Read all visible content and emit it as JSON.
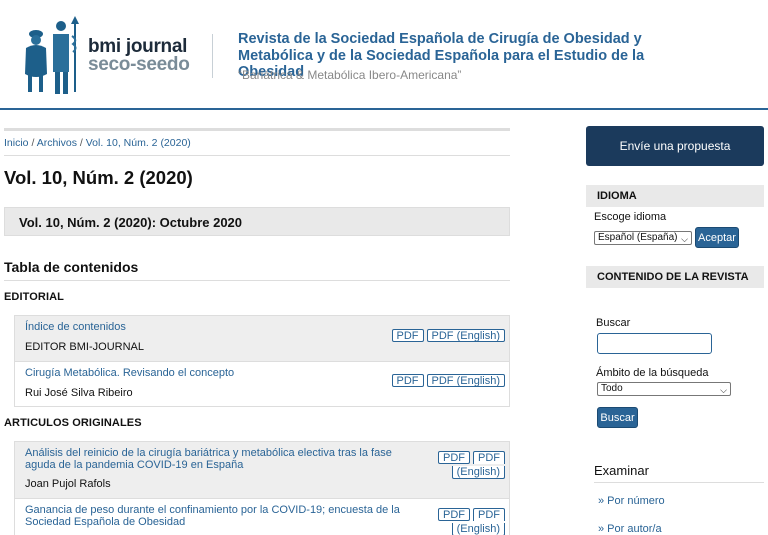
{
  "header": {
    "logo_line1": "bmi journal",
    "logo_line2": "seco-seedo",
    "title": "Revista de la Sociedad Española de Cirugía de Obesidad y Metabólica y de la Sociedad Española para el Estudio de la Obesidad",
    "subtitle": "“Bariátrica & Metabólica Ibero-Americana”"
  },
  "breadcrumb": {
    "home": "Inicio",
    "archives": "Archivos",
    "current": "Vol. 10, Núm. 2 (2020)",
    "separator": "/"
  },
  "page_title": "Vol. 10, Núm. 2 (2020)",
  "issue_label": "Vol. 10, Núm. 2 (2020): Octubre 2020",
  "toc_heading": "Tabla de contenidos",
  "sections": [
    {
      "heading": "EDITORIAL",
      "articles": [
        {
          "title": "Índice de contenidos",
          "author": "EDITOR BMI-JOURNAL",
          "galleys": [
            "PDF",
            "PDF (English)"
          ]
        },
        {
          "title": "Cirugía Metabólica. Revisando el concepto",
          "author": "Rui José Silva Ribeiro",
          "galleys": [
            "PDF",
            "PDF (English)"
          ]
        }
      ]
    },
    {
      "heading": "ARTICULOS ORIGINALES",
      "articles": [
        {
          "title_line1": "Análisis del reinicio de la cirugía bariátrica y metabólica electiva tras la fase",
          "title_line2": "aguda de la pandemia COVID-19 en España",
          "author": "Joan Pujol Rafols",
          "galley1": "PDF",
          "galley2_line1": "PDF",
          "galley2_line2": "(English)"
        },
        {
          "title_line1": "Ganancia de peso durante el confinamiento por la COVID-19; encuesta de la",
          "title_line2": "Sociedad Española de Obesidad",
          "galley1": "PDF",
          "galley2_line1": "PDF",
          "galley2_line2": "(English)"
        }
      ]
    }
  ],
  "sidebar": {
    "submit_label": "Envíe una propuesta",
    "language": {
      "title": "IDIOMA",
      "choose_label": "Escoge idioma",
      "selected": "Español (España)",
      "button": "Aceptar"
    },
    "content": {
      "title": "CONTENIDO DE LA REVISTA",
      "search_label": "Buscar",
      "scope_label": "Ámbito de la búsqueda",
      "scope_selected": "Todo",
      "search_button": "Buscar"
    },
    "browse": {
      "heading": "Examinar",
      "links": [
        "» Por número",
        "» Por autor/a"
      ]
    }
  },
  "colors": {
    "link": "#2a6496",
    "submit_bg": "#1b3a5c",
    "panel_grey": "#e9e9e9"
  }
}
